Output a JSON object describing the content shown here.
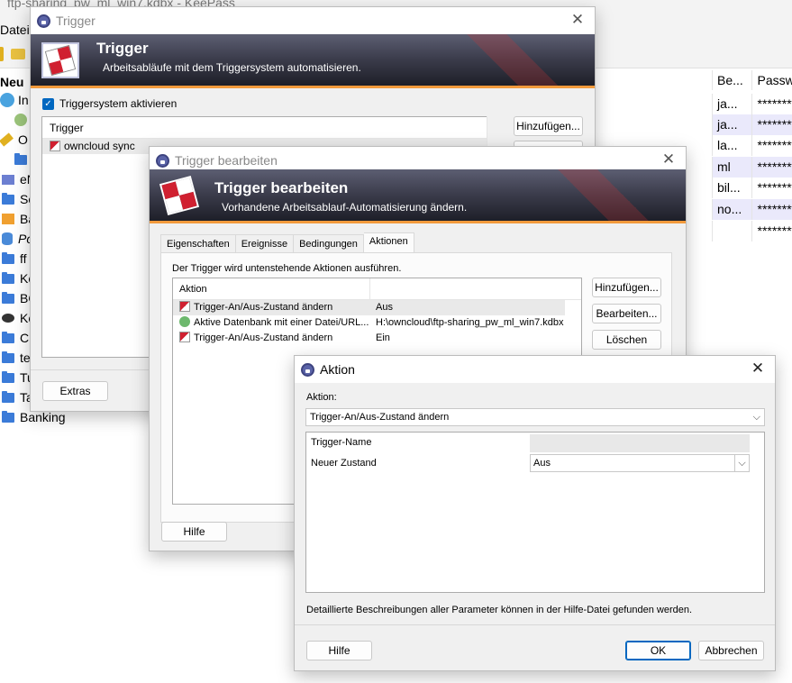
{
  "main_window": {
    "title": "ftp-sharing_pw_ml_win7.kdbx - KeePass",
    "menu_datei": "Datei",
    "tree_header": "Neu",
    "tree": [
      {
        "label": "In",
        "icon": "globe-icon"
      },
      {
        "label": "",
        "icon": "user-icon"
      },
      {
        "label": "O",
        "icon": "key-icon"
      },
      {
        "label": "",
        "icon": "folder-icon"
      },
      {
        "label": "eN",
        "icon": "mail-icon"
      },
      {
        "label": "So",
        "icon": "folder-icon"
      },
      {
        "label": "Ba",
        "icon": "bank-icon"
      },
      {
        "label": "Po",
        "icon": "database-icon"
      },
      {
        "label": "ff",
        "icon": "folder-icon"
      },
      {
        "label": "Ke",
        "icon": "folder-icon"
      },
      {
        "label": "BO",
        "icon": "folder-icon"
      },
      {
        "label": "Ke",
        "icon": "gear-icon"
      },
      {
        "label": "Cr",
        "icon": "folder-icon"
      },
      {
        "label": "te",
        "icon": "folder-icon"
      },
      {
        "label": "Tu",
        "icon": "folder-icon"
      },
      {
        "label": "Ta",
        "icon": "folder-icon"
      },
      {
        "label": "Banking",
        "icon": "folder-icon"
      }
    ],
    "columns": {
      "be": "Be...",
      "passwort": "Passwo"
    },
    "rows": [
      {
        "be": "ja...",
        "pw": "********"
      },
      {
        "be": "ja...",
        "pw": "********"
      },
      {
        "be": "la...",
        "pw": "********"
      },
      {
        "be": "ml",
        "pw": "********"
      },
      {
        "be": "bil...",
        "pw": "********"
      },
      {
        "be": "no...",
        "pw": "********"
      },
      {
        "be": "",
        "pw": "********"
      }
    ]
  },
  "trigger_dialog": {
    "title": "Trigger",
    "banner_title": "Trigger",
    "banner_subtitle": "Arbeitsabläufe mit dem Triggersystem automatisieren.",
    "checkbox_label": "Triggersystem aktivieren",
    "list_header": "Trigger",
    "list_items": [
      "owncloud sync"
    ],
    "add_button": "Hinzufügen...",
    "extras_button": "Extras"
  },
  "edit_dialog": {
    "title": "Trigger bearbeiten",
    "banner_title": "Trigger bearbeiten",
    "banner_subtitle": "Vorhandene Arbeitsablauf-Automatisierung ändern.",
    "tabs": [
      "Eigenschaften",
      "Ereignisse",
      "Bedingungen",
      "Aktionen"
    ],
    "info_text": "Der Trigger wird untenstehende Aktionen ausführen.",
    "list_header": "Aktion",
    "actions": [
      {
        "name": "Trigger-An/Aus-Zustand ändern",
        "value": "Aus"
      },
      {
        "name": "Aktive Datenbank mit einer Datei/URL...",
        "value": "H:\\owncloud\\ftp-sharing_pw_ml_win7.kdbx"
      },
      {
        "name": "Trigger-An/Aus-Zustand ändern",
        "value": "Ein"
      }
    ],
    "add_button": "Hinzufügen...",
    "edit_button": "Bearbeiten...",
    "delete_button": "Löschen",
    "help_button": "Hilfe"
  },
  "action_dialog": {
    "title": "Aktion",
    "action_label": "Aktion:",
    "action_value": "Trigger-An/Aus-Zustand ändern",
    "params": [
      {
        "name": "Trigger-Name",
        "value": ""
      },
      {
        "name": "Neuer Zustand",
        "value": "Aus"
      }
    ],
    "footer_text": "Detaillierte Beschreibungen aller Parameter können in der Hilfe-Datei gefunden werden.",
    "help_button": "Hilfe",
    "ok_button": "OK",
    "cancel_button": "Abbrechen"
  }
}
